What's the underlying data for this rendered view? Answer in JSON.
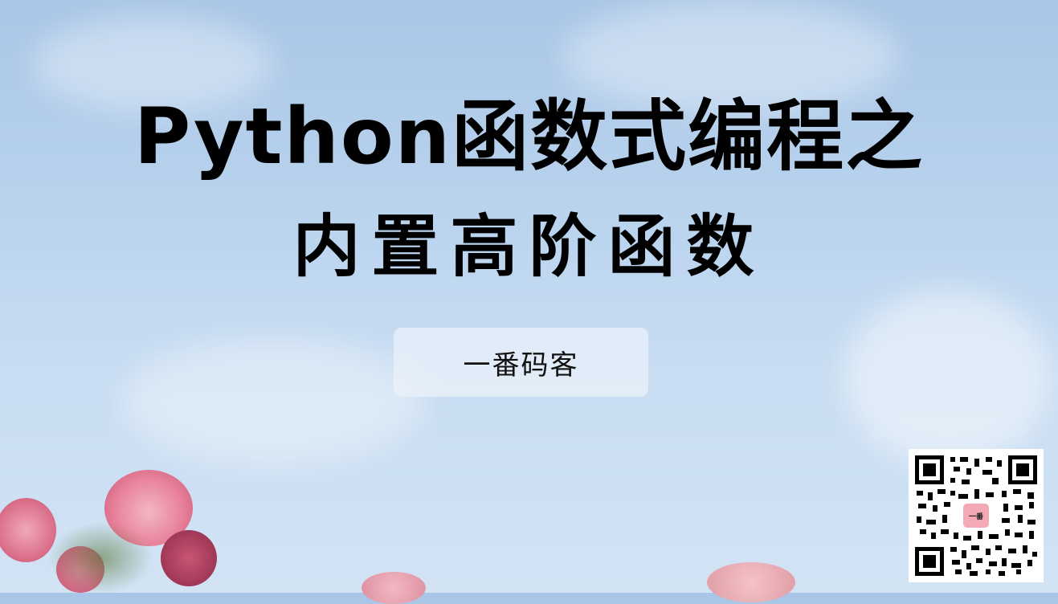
{
  "title": {
    "line1": "Python函数式编程之",
    "line2": "内置高阶函数"
  },
  "author_badge": {
    "label": "一番码客"
  },
  "qr_code": {
    "logo_text": "一番"
  },
  "colors": {
    "sky_top": "#a9c6e6",
    "sky_bottom": "#d2e3f4",
    "title_text": "#000000",
    "flower_pink": "#e8829a",
    "qr_logo_bg": "#f4a9b4"
  }
}
